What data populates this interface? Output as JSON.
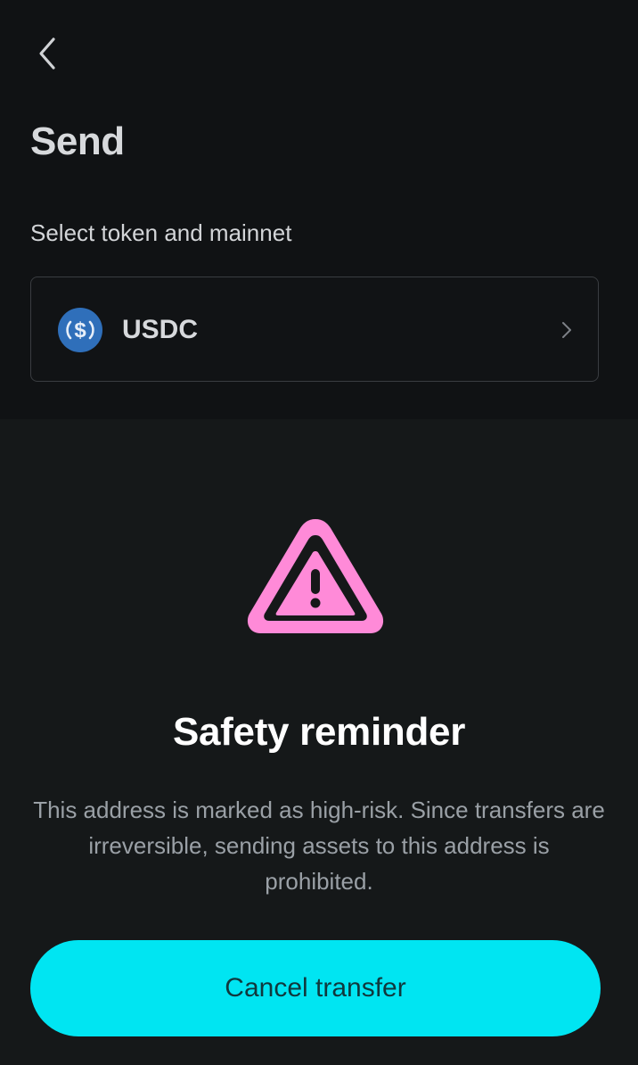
{
  "header": {
    "title": "Send"
  },
  "token_section": {
    "label": "Select token and mainnet",
    "selected_token": "USDC",
    "token_icon": "usdc-coin-icon"
  },
  "icons": {
    "back": "chevron-left-icon",
    "select": "chevron-right-icon",
    "warning": "warning-triangle-icon"
  },
  "colors": {
    "accent": "#00e5f2",
    "warning": "#ff8ad8",
    "usdc": "#2775ca"
  },
  "dialog": {
    "title": "Safety reminder",
    "message": "This address is marked as high-risk. Since transfers are irreversible, sending assets to this address is prohibited.",
    "cancel_label": "Cancel transfer"
  }
}
